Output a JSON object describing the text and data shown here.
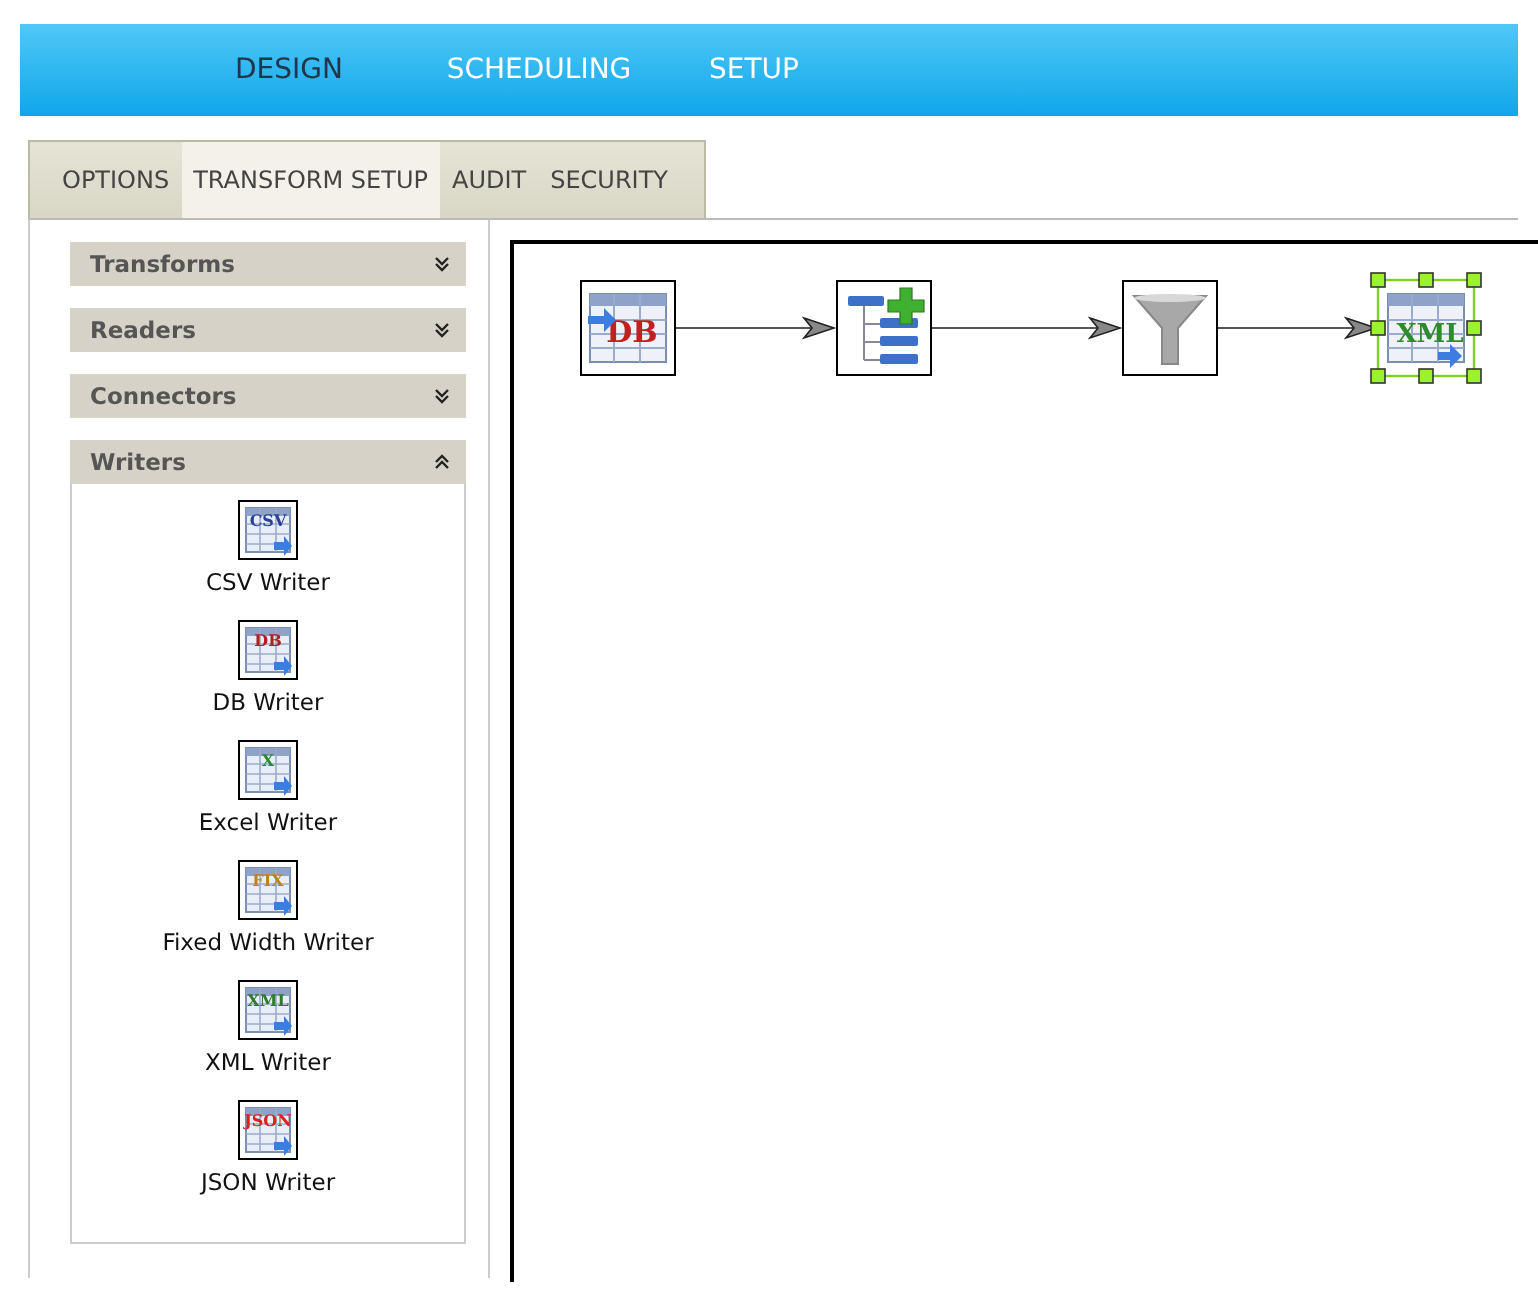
{
  "nav": [
    {
      "label": "DESIGN",
      "selected": true
    },
    {
      "label": "SCHEDULING",
      "selected": false
    },
    {
      "label": "SETUP",
      "selected": false
    }
  ],
  "tabs": [
    {
      "label": "OPTIONS",
      "selected": false
    },
    {
      "label": "TRANSFORM SETUP",
      "selected": true
    },
    {
      "label": "AUDIT",
      "selected": false
    },
    {
      "label": "SECURITY",
      "selected": false
    }
  ],
  "palette": [
    {
      "title": "Transforms",
      "expanded": false
    },
    {
      "title": "Readers",
      "expanded": false
    },
    {
      "title": "Connectors",
      "expanded": false
    },
    {
      "title": "Writers",
      "expanded": true,
      "items": [
        {
          "label": "CSV Writer",
          "badge": "CSV",
          "color": "#2a3fa0"
        },
        {
          "label": "DB Writer",
          "badge": "DB",
          "color": "#b02020"
        },
        {
          "label": "Excel Writer",
          "badge": "X",
          "color": "#2f8a2f"
        },
        {
          "label": "Fixed Width Writer",
          "badge": "FIX",
          "color": "#c08020"
        },
        {
          "label": "XML Writer",
          "badge": "XML",
          "color": "#2f7a2f"
        },
        {
          "label": "JSON Writer",
          "badge": "JSON",
          "color": "#e02020"
        }
      ]
    }
  ],
  "canvas": {
    "nodes": [
      {
        "kind": "table",
        "badge": "DB",
        "selected": false
      },
      {
        "kind": "mapping",
        "selected": false
      },
      {
        "kind": "filter",
        "selected": false
      },
      {
        "kind": "table",
        "badge": "XML",
        "selected": true
      }
    ]
  }
}
